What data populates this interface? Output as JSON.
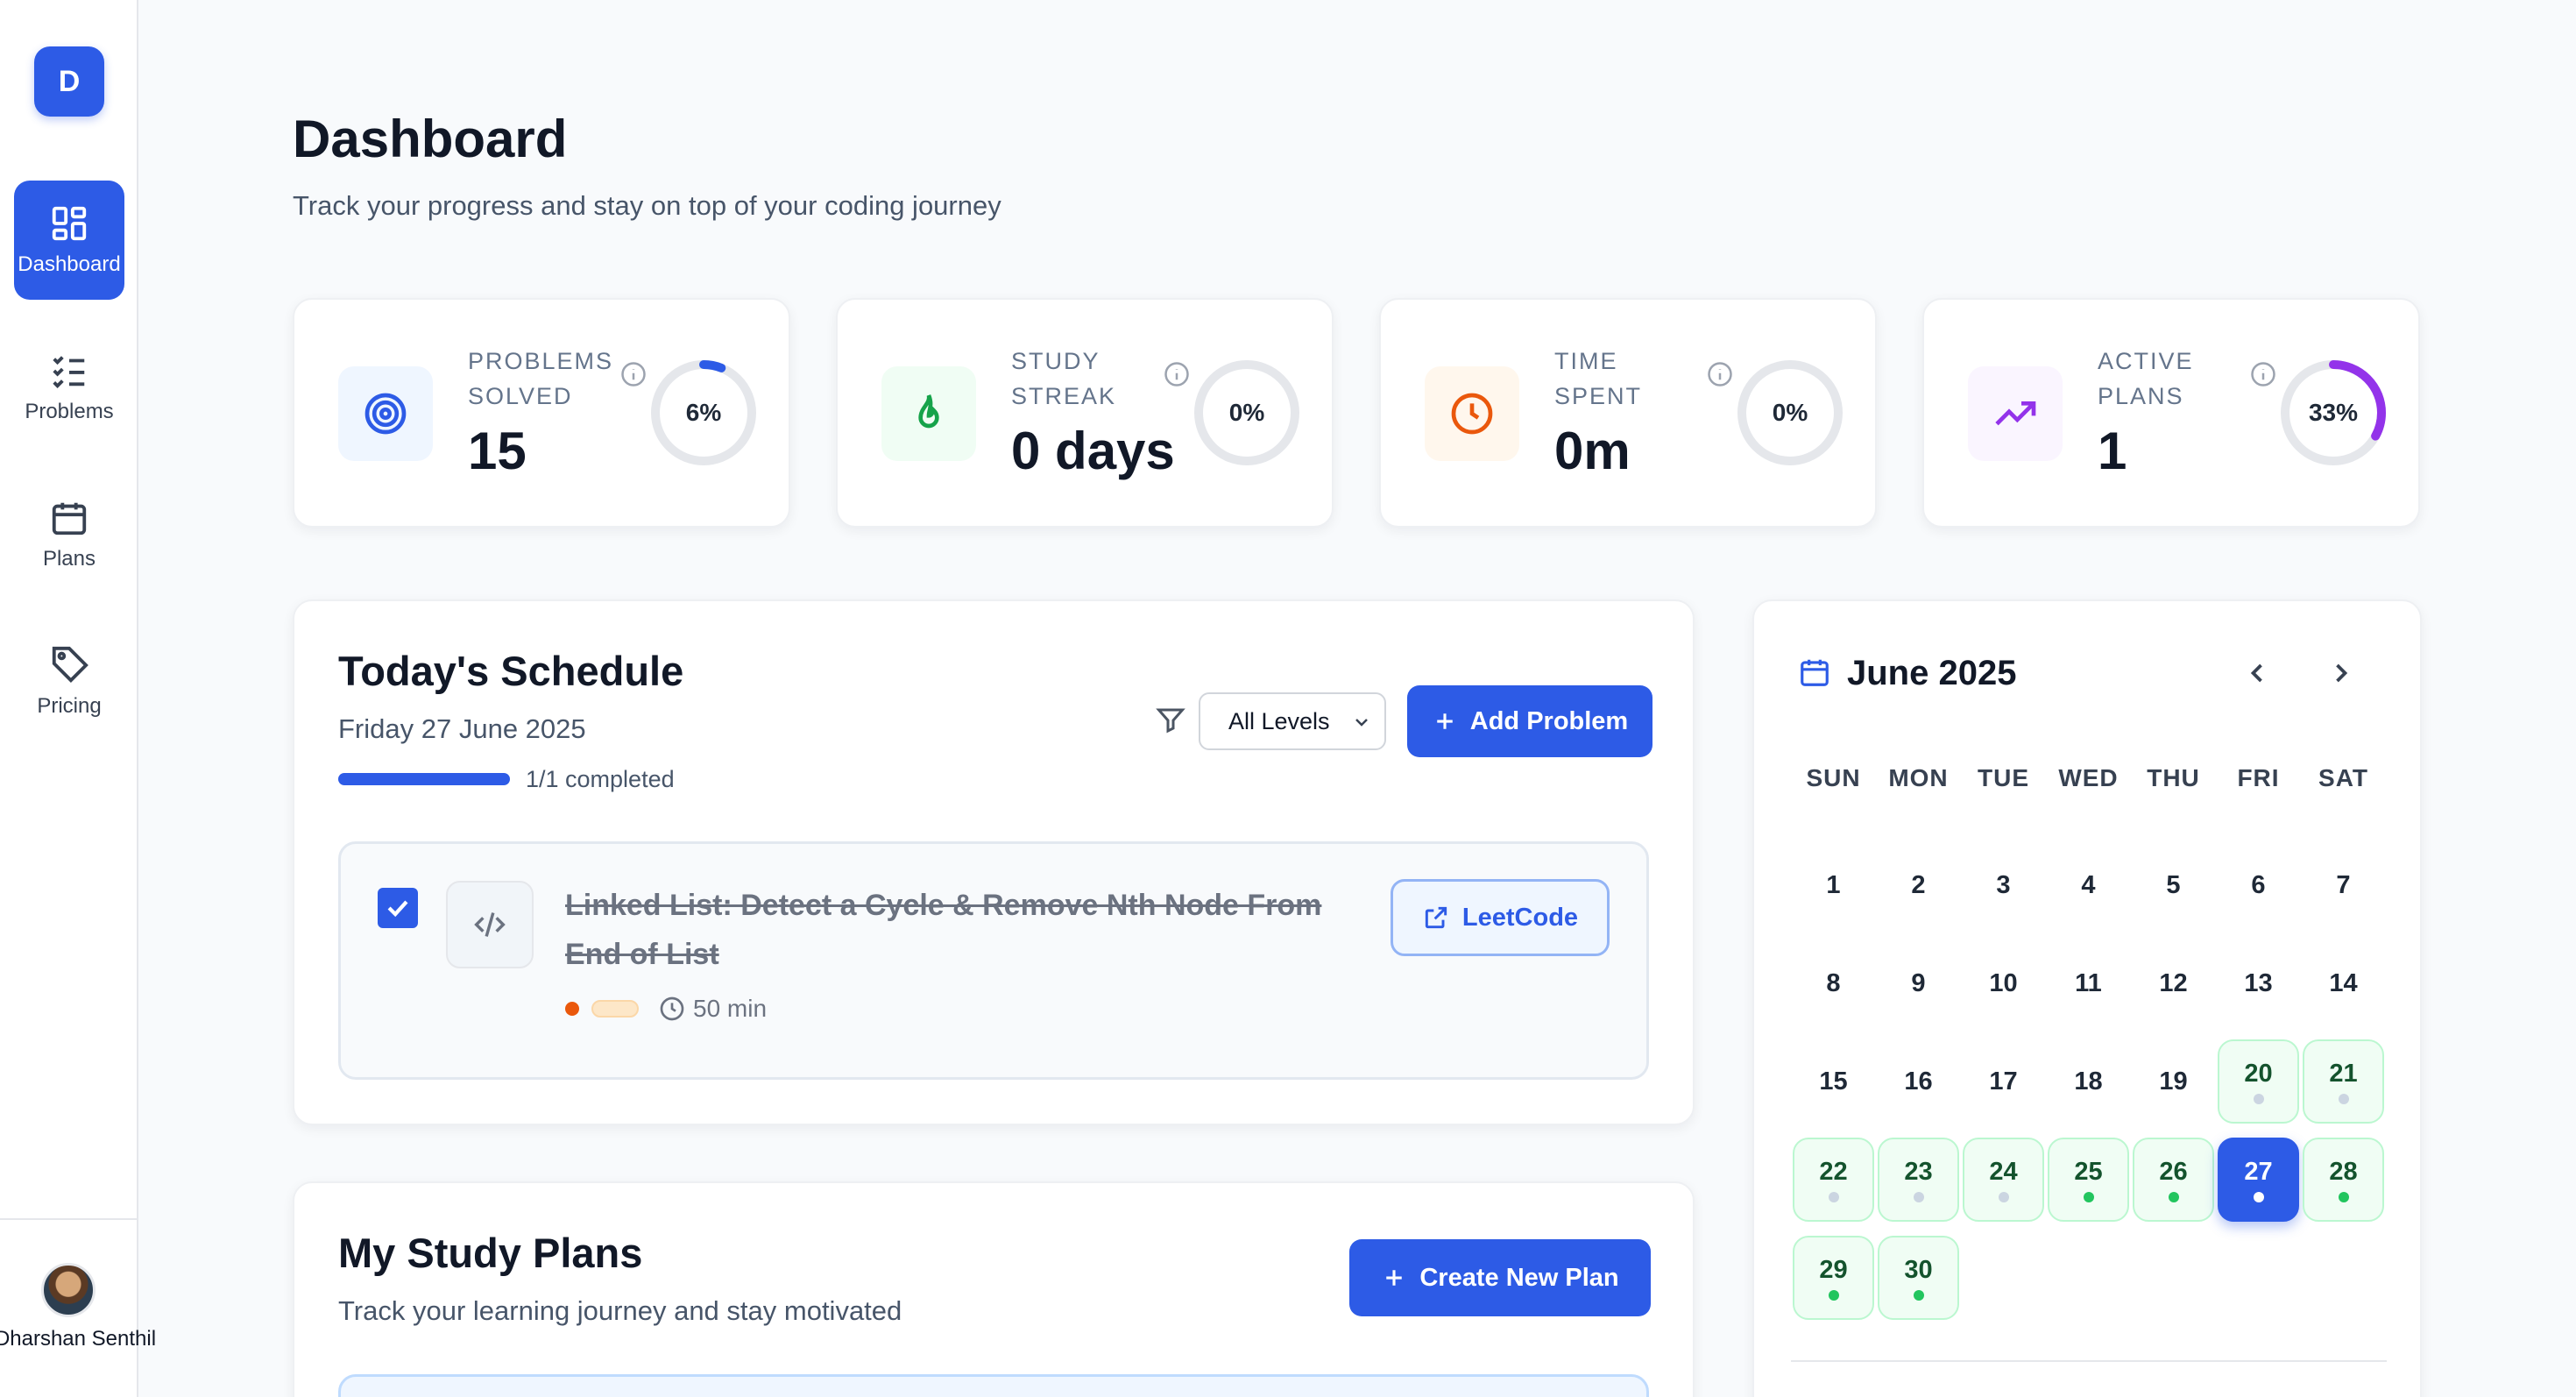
{
  "sidebar": {
    "logo": "D",
    "items": [
      {
        "label": "Dashboard",
        "icon": "dashboard-grid-icon",
        "active": true
      },
      {
        "label": "Problems",
        "icon": "list-check-icon",
        "active": false
      },
      {
        "label": "Plans",
        "icon": "calendar-icon",
        "active": false
      },
      {
        "label": "Pricing",
        "icon": "tag-icon",
        "active": false
      }
    ],
    "user_name": "Dharshan Senthil"
  },
  "header": {
    "title": "Dashboard",
    "subtitle": "Track your progress and stay on top of your coding journey"
  },
  "stats": [
    {
      "label": "Problems Solved",
      "value": "15",
      "percent_label": "6%",
      "percent": 6,
      "icon": "target-icon",
      "color": "#2d5be6",
      "bg": "#eff6ff"
    },
    {
      "label": "Study Streak",
      "value": "0 days",
      "percent_label": "0%",
      "percent": 0,
      "icon": "flame-icon",
      "color": "#16a34a",
      "bg": "#f0fdf4"
    },
    {
      "label": "Time Spent",
      "value": "0m",
      "percent_label": "0%",
      "percent": 0,
      "icon": "clock-icon",
      "color": "#ea580c",
      "bg": "#fff7ed"
    },
    {
      "label": "Active Plans",
      "value": "1",
      "percent_label": "33%",
      "percent": 33,
      "icon": "trending-up-icon",
      "color": "#9333ea",
      "bg": "#faf5ff"
    }
  ],
  "schedule": {
    "title": "Today's Schedule",
    "date": "Friday 27 June 2025",
    "progress_text": "1/1 completed",
    "progress": 1.0,
    "filter_value": "All Levels",
    "add_button": "Add Problem",
    "problem": {
      "title": "Linked List: Detect a Cycle & Remove Nth Node From End of List",
      "checked": true,
      "time": "50 min",
      "link_label": "LeetCode"
    }
  },
  "plans": {
    "title": "My Study Plans",
    "subtitle": "Track your learning journey and stay motivated",
    "create_button": "Create New Plan"
  },
  "calendar": {
    "month": "June 2025",
    "weekdays": [
      "SUN",
      "MON",
      "TUE",
      "WED",
      "THU",
      "FRI",
      "SAT"
    ],
    "start_offset": 0,
    "days": [
      {
        "d": "1"
      },
      {
        "d": "2"
      },
      {
        "d": "3"
      },
      {
        "d": "4"
      },
      {
        "d": "5"
      },
      {
        "d": "6"
      },
      {
        "d": "7"
      },
      {
        "d": "8"
      },
      {
        "d": "9"
      },
      {
        "d": "10"
      },
      {
        "d": "11"
      },
      {
        "d": "12"
      },
      {
        "d": "13"
      },
      {
        "d": "14"
      },
      {
        "d": "15"
      },
      {
        "d": "16"
      },
      {
        "d": "17"
      },
      {
        "d": "18"
      },
      {
        "d": "19"
      },
      {
        "d": "20",
        "mark": true,
        "dot": "#cbd5e1"
      },
      {
        "d": "21",
        "mark": true,
        "dot": "#cbd5e1"
      },
      {
        "d": "22",
        "mark": true,
        "dot": "#cbd5e1"
      },
      {
        "d": "23",
        "mark": true,
        "dot": "#cbd5e1"
      },
      {
        "d": "24",
        "mark": true,
        "dot": "#cbd5e1"
      },
      {
        "d": "25",
        "mark": true,
        "dot": "#22c55e"
      },
      {
        "d": "26",
        "mark": true,
        "dot": "#22c55e"
      },
      {
        "d": "27",
        "today": true,
        "dot": "#ffffff"
      },
      {
        "d": "28",
        "mark": true,
        "dot": "#22c55e"
      },
      {
        "d": "29",
        "mark": true,
        "dot": "#22c55e"
      },
      {
        "d": "30",
        "mark": true,
        "dot": "#22c55e"
      }
    ]
  }
}
